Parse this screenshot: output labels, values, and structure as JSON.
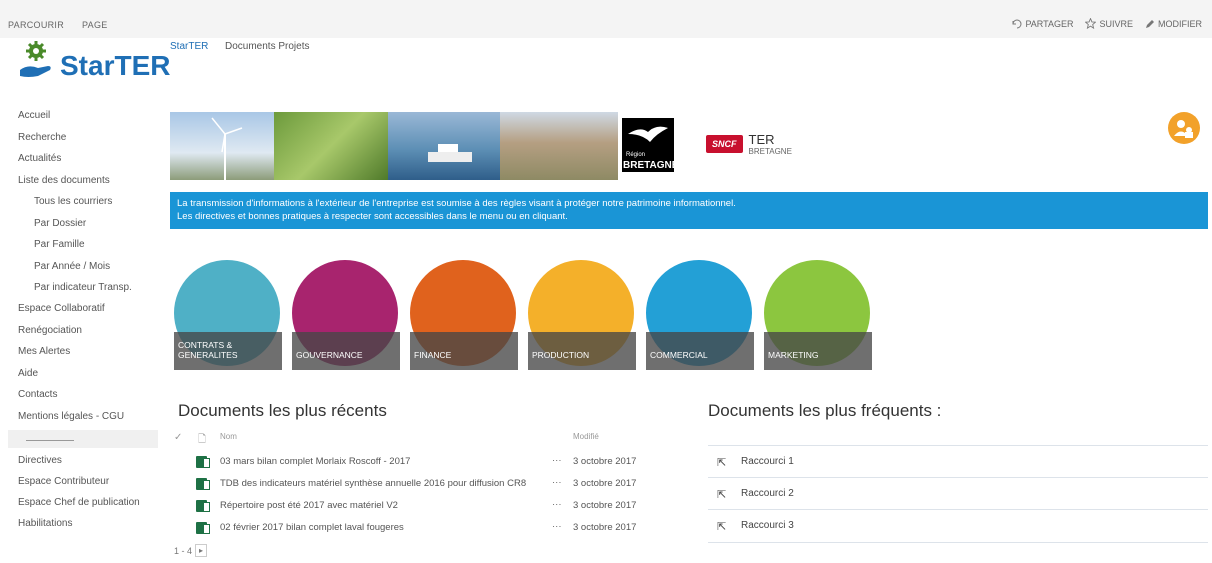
{
  "topbar": {
    "browse": "PARCOURIR",
    "page": "PAGE",
    "share": "PARTAGER",
    "follow": "SUIVRE",
    "edit": "MODIFIER"
  },
  "site": {
    "name": "StarTER"
  },
  "breadcrumb": {
    "site": "StarTER",
    "page": "Documents Projets"
  },
  "nav": {
    "items": [
      "Accueil",
      "Recherche",
      "Actualités",
      "Liste des documents"
    ],
    "sub": [
      "Tous les courriers",
      "Par Dossier",
      "Par Famille",
      "Par Année / Mois",
      "Par indicateur Transp."
    ],
    "items2": [
      "Espace Collaboratif",
      "Renégociation",
      "Mes Alertes",
      "Aide",
      "Contacts",
      "Mentions légales - CGU"
    ],
    "items3": [
      "Directives",
      "Espace Contributeur",
      "Espace Chef de publication",
      "Habilitations"
    ]
  },
  "banner": {
    "region_small": "Région",
    "region": "BRETAGNE",
    "sncf": "SNCF",
    "ter": "TER",
    "ter_sub": "BRETAGNE"
  },
  "info": {
    "line1": "La transmission d'informations à l'extérieur de l'entreprise est soumise à des règles visant à protéger notre patrimoine informationnel.",
    "line2": "Les directives et bonnes pratiques à respecter sont accessibles dans le menu ou en cliquant."
  },
  "tiles": [
    {
      "label": "CONTRATS & GENERALITES",
      "color": "#4fb0c6"
    },
    {
      "label": "GOUVERNANCE",
      "color": "#a8246e"
    },
    {
      "label": "FINANCE",
      "color": "#e0621d"
    },
    {
      "label": "PRODUCTION",
      "color": "#f4b02a"
    },
    {
      "label": "COMMERCIAL",
      "color": "#23a0d6"
    },
    {
      "label": "MARKETING",
      "color": "#8cc63f"
    }
  ],
  "recent": {
    "title": "Documents les plus récents",
    "col_name": "Nom",
    "col_modified": "Modifié",
    "rows": [
      {
        "name": "03 mars bilan complet Morlaix Roscoff - 2017",
        "date": "3 octobre 2017"
      },
      {
        "name": "TDB des indicateurs matériel synthèse annuelle 2016 pour diffusion CR8",
        "date": "3 octobre 2017"
      },
      {
        "name": "Répertoire post été 2017 avec matériel V2",
        "date": "3 octobre 2017"
      },
      {
        "name": "02 février 2017 bilan complet laval fougeres",
        "date": "3 octobre 2017"
      }
    ],
    "pager": "1 - 4",
    "more": "···",
    "next": "▸"
  },
  "frequent": {
    "title": "Documents les plus fréquents :",
    "items": [
      "Raccourci 1",
      "Raccourci 2",
      "Raccourci 3"
    ]
  }
}
